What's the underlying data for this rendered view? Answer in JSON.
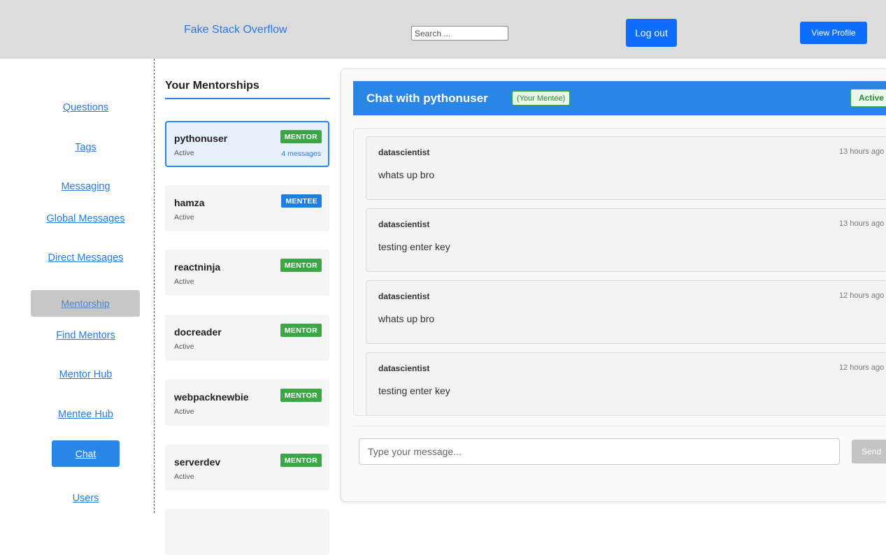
{
  "header": {
    "site_title": "Fake Stack Overflow",
    "search_placeholder": "Search ...",
    "logout_label": "Log out",
    "view_profile_label": "View Profile"
  },
  "sidebar": {
    "items": [
      {
        "label": "Questions"
      },
      {
        "label": "Tags"
      },
      {
        "label": "Messaging"
      },
      {
        "label": "Global Messages"
      },
      {
        "label": "Direct Messages"
      },
      {
        "label": "Mentorship"
      },
      {
        "label": "Find Mentors"
      },
      {
        "label": "Mentor Hub"
      },
      {
        "label": "Mentee Hub"
      },
      {
        "label": "Chat"
      },
      {
        "label": "Users"
      }
    ]
  },
  "mentorships": {
    "title": "Your Mentorships",
    "items": [
      {
        "name": "pythonuser",
        "role": "MENTOR",
        "status": "Active",
        "message_count": "4 messages",
        "selected": true
      },
      {
        "name": "hamza",
        "role": "MENTEE",
        "status": "Active"
      },
      {
        "name": "reactninja",
        "role": "MENTOR",
        "status": "Active"
      },
      {
        "name": "docreader",
        "role": "MENTOR",
        "status": "Active"
      },
      {
        "name": "webpacknewbie",
        "role": "MENTOR",
        "status": "Active"
      },
      {
        "name": "serverdev",
        "role": "MENTOR",
        "status": "Active"
      }
    ]
  },
  "chat": {
    "title": "Chat with pythonuser",
    "relation": "(Your Mentee)",
    "status": "Active",
    "messages": [
      {
        "sender": "datascientist",
        "time": "13 hours ago",
        "text": "whats up bro"
      },
      {
        "sender": "datascientist",
        "time": "13 hours ago",
        "text": "testing enter key"
      },
      {
        "sender": "datascientist",
        "time": "12 hours ago",
        "text": "whats up bro"
      },
      {
        "sender": "datascientist",
        "time": "12 hours ago",
        "text": "testing enter key"
      }
    ],
    "input_placeholder": "Type your message...",
    "send_label": "Send"
  },
  "colors": {
    "primary_blue": "#0d6efd",
    "accent_blue": "#2a86e6",
    "mentor_green": "#3aa845",
    "mentee_blue": "#1f7fe0",
    "header_grey": "#dcdcdc"
  }
}
